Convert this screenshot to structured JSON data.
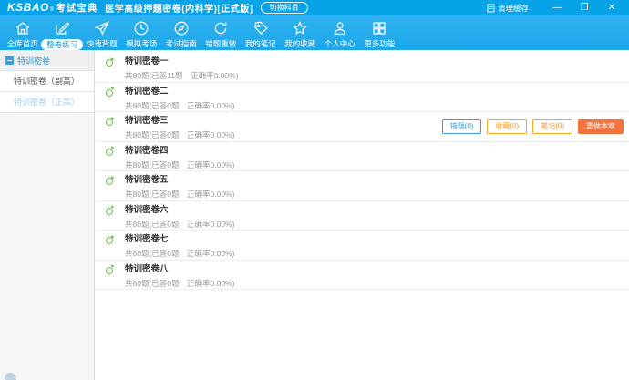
{
  "titlebar": {
    "logo": "KSBAO",
    "logo_reg": "®",
    "logo_cn": "考试宝典",
    "title": "医学高级押题密卷(内科学)[正式版]",
    "switch_subject": "切换科目",
    "clear_cache": "清理缓存",
    "minimize": "—",
    "maximize": "❐",
    "close": "✕"
  },
  "nav": {
    "items": [
      {
        "label": "全库首页",
        "icon": "home-icon"
      },
      {
        "label": "整卷练习",
        "icon": "edit-icon",
        "active": true
      },
      {
        "label": "快速背题",
        "icon": "plane-icon"
      },
      {
        "label": "模拟考场",
        "icon": "clock-icon"
      },
      {
        "label": "考试指南",
        "icon": "compass-icon"
      },
      {
        "label": "错题重做",
        "icon": "redo-icon"
      },
      {
        "label": "我的笔记",
        "icon": "tag-icon"
      },
      {
        "label": "我的收藏",
        "icon": "star-icon"
      },
      {
        "label": "个人中心",
        "icon": "user-icon"
      },
      {
        "label": "更多功能",
        "icon": "grid-icon"
      }
    ]
  },
  "sidebar": {
    "root": "特训密卷",
    "items": [
      {
        "label": "特训密卷（副高）",
        "state": "current"
      },
      {
        "label": "特训密卷（正高）",
        "state": "dim"
      }
    ]
  },
  "list": {
    "rows": [
      {
        "title": "特训密卷一",
        "subtitle": "共80题(已答11题　正确率0.00%)"
      },
      {
        "title": "特训密卷二",
        "subtitle": "共80题(已答0题　正确率0.00%)"
      },
      {
        "title": "特训密卷三",
        "subtitle": "共80题(已答0题　正确率0.00%)"
      },
      {
        "title": "特训密卷四",
        "subtitle": "共80题(已答0题　正确率0.00%)"
      },
      {
        "title": "特训密卷五",
        "subtitle": "共80题(已答0题　正确率0.00%)"
      },
      {
        "title": "特训密卷六",
        "subtitle": "共80题(已答0题　正确率0.00%)"
      },
      {
        "title": "特训密卷七",
        "subtitle": "共80题(已答0题　正确率0.00%)"
      },
      {
        "title": "特训密卷八",
        "subtitle": "共80题(已答0题　正确率0.00%)"
      }
    ],
    "actions": {
      "wrong": "错题(0)",
      "favorite": "收藏(0)",
      "note": "笔记(0)",
      "redo": "重做本章"
    }
  },
  "colors": {
    "titlebar_blue": "#06a3e9",
    "nav_blue": "#1ca7ec",
    "accent_blue": "#3f9bd9",
    "accent_orange": "#f59a23",
    "redo_orange": "#f3733f",
    "progress_green": "#6abf4b"
  }
}
